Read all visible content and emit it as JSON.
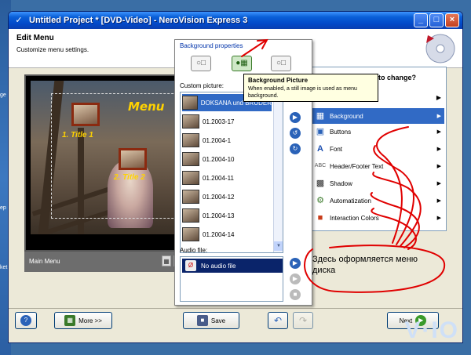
{
  "window": {
    "title": "Untitled Project * [DVD-Video] - NeroVision Express 3"
  },
  "header": {
    "title": "Edit Menu",
    "subtitle": "Customize menu settings."
  },
  "preview": {
    "menu_title": "Menu",
    "title1": "1. Title 1",
    "title2": "2. Title 2",
    "bar_label": "Main Menu"
  },
  "popup": {
    "heading": "Background properties",
    "custom_picture_label": "Custom picture:",
    "audio_label": "Audio file:",
    "pictures": [
      {
        "name": "DOKSANA und BRUDER",
        "selected": true
      },
      {
        "name": "01.2003-17"
      },
      {
        "name": "01.2004-1"
      },
      {
        "name": "01.2004-10"
      },
      {
        "name": "01.2004-11"
      },
      {
        "name": "01.2004-12"
      },
      {
        "name": "01.2004-13"
      },
      {
        "name": "01.2004-14"
      }
    ],
    "audio_item": "No audio file"
  },
  "tooltip": {
    "title": "Background Picture",
    "text": "When enabled, a still image is used as menu background."
  },
  "right_panel": {
    "heading": "to change?",
    "categories": [
      {
        "label": "Background",
        "selected": true,
        "icon": "background-icon"
      },
      {
        "label": "Buttons",
        "icon": "buttons-icon"
      },
      {
        "label": "Font",
        "icon": "font-icon"
      },
      {
        "label": "Header/Footer Text",
        "icon": "text-icon"
      },
      {
        "label": "Shadow",
        "icon": "shadow-icon"
      },
      {
        "label": "Automatization",
        "icon": "automatization-icon"
      },
      {
        "label": "Interaction Colors",
        "icon": "colors-icon"
      }
    ]
  },
  "footer": {
    "more_label": "More >>",
    "save_label": "Save",
    "next_label": "Next"
  },
  "annotation": {
    "text": "Здесь оформляется меню диска"
  },
  "desktop": {
    "text1": "ge",
    "text2": "ep",
    "text3": "ket"
  },
  "colors": {
    "title_blue": "#0249c8",
    "selection": "#316ac5",
    "annotation_red": "#e00000"
  }
}
